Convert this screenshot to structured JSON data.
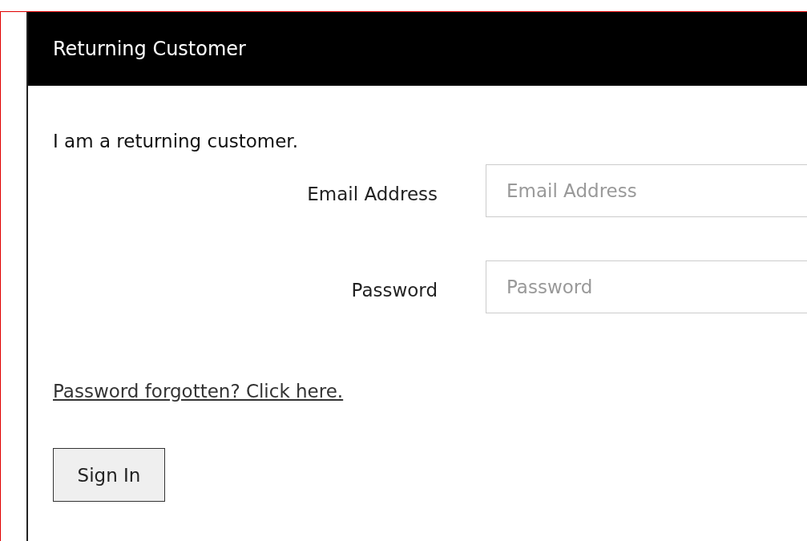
{
  "panel": {
    "title": "Returning Customer"
  },
  "intro": "I am a returning customer.",
  "fields": [
    {
      "label": "Email Address",
      "placeholder": "Email Address"
    },
    {
      "label": "Password",
      "placeholder": "Password"
    }
  ],
  "forgot_link": "Password forgotten? Click here.",
  "submit": "Sign In"
}
